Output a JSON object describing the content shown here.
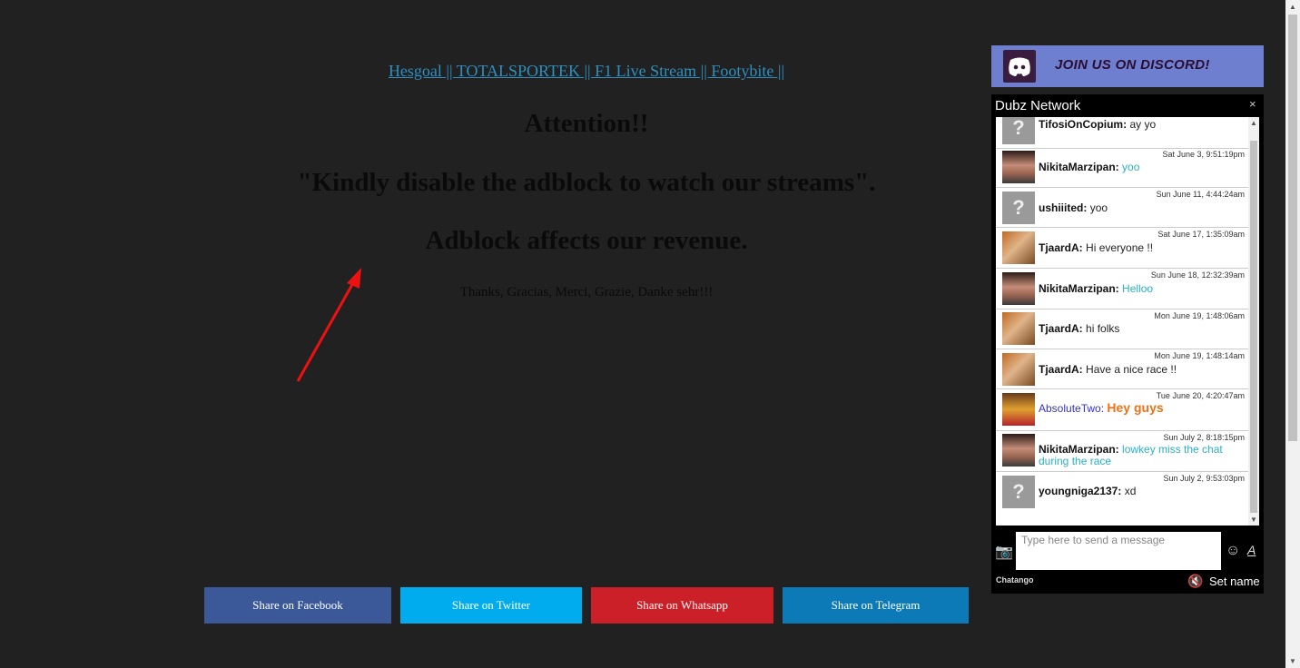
{
  "top_links": "Hesgoal || TOTALSPORTEK || F1 Live Stream || Footybite ||",
  "heading1": "Attention!!",
  "heading2": "\"Kindly disable the adblock to watch our streams\".",
  "heading3": "Adblock affects our revenue.",
  "thanks": "Thanks, Gracias, Merci, Grazie, Danke sehr!!!",
  "share": {
    "facebook": "Share on Facebook",
    "twitter": "Share on Twitter",
    "whatsapp": "Share on Whatsapp",
    "telegram": "Share on Telegram"
  },
  "colors": {
    "facebook": "#3b5998",
    "twitter": "#00aced",
    "whatsapp": "#cb2027",
    "telegram": "#0d7ab8"
  },
  "discord": {
    "text": "JOIN US ON DISCORD!"
  },
  "chat": {
    "title": "Dubz Network",
    "close": "×",
    "messages": [
      {
        "time": "",
        "name": "TifosiOnCopium:",
        "text": "ay yo",
        "avatar": "q"
      },
      {
        "time": "Sat June 3, 9:51:19pm",
        "name": "NikitaMarzipan:",
        "text": "yoo",
        "avatar": "n"
      },
      {
        "time": "Sun June 11, 4:44:24am",
        "name": "ushiiited:",
        "text": "yoo",
        "avatar": "q"
      },
      {
        "time": "Sat June 17, 1:35:09am",
        "name": "TjaardA:",
        "text": "Hi everyone !!",
        "avatar": "t"
      },
      {
        "time": "Sun June 18, 12:32:39am",
        "name": "NikitaMarzipan:",
        "text": "Helloo",
        "avatar": "n"
      },
      {
        "time": "Mon June 19, 1:48:06am",
        "name": "TjaardA:",
        "text": "hi folks",
        "avatar": "t"
      },
      {
        "time": "Mon June 19, 1:48:14am",
        "name": "TjaardA:",
        "text": "Have a nice race !!",
        "avatar": "t"
      },
      {
        "time": "Tue June 20, 4:20:47am",
        "name": "AbsoluteTwo:",
        "text": "Hey guys",
        "avatar": "a"
      },
      {
        "time": "Sun July 2, 8:18:15pm",
        "name": "NikitaMarzipan:",
        "text": "lowkey miss the chat during the race",
        "avatar": "n"
      },
      {
        "time": "Sun July 2, 9:53:03pm",
        "name": "youngniga2137:",
        "text": "xd",
        "avatar": "q"
      }
    ],
    "input_placeholder": "Type here to send a message",
    "brand": "Chatango",
    "set_name": "Set name"
  }
}
